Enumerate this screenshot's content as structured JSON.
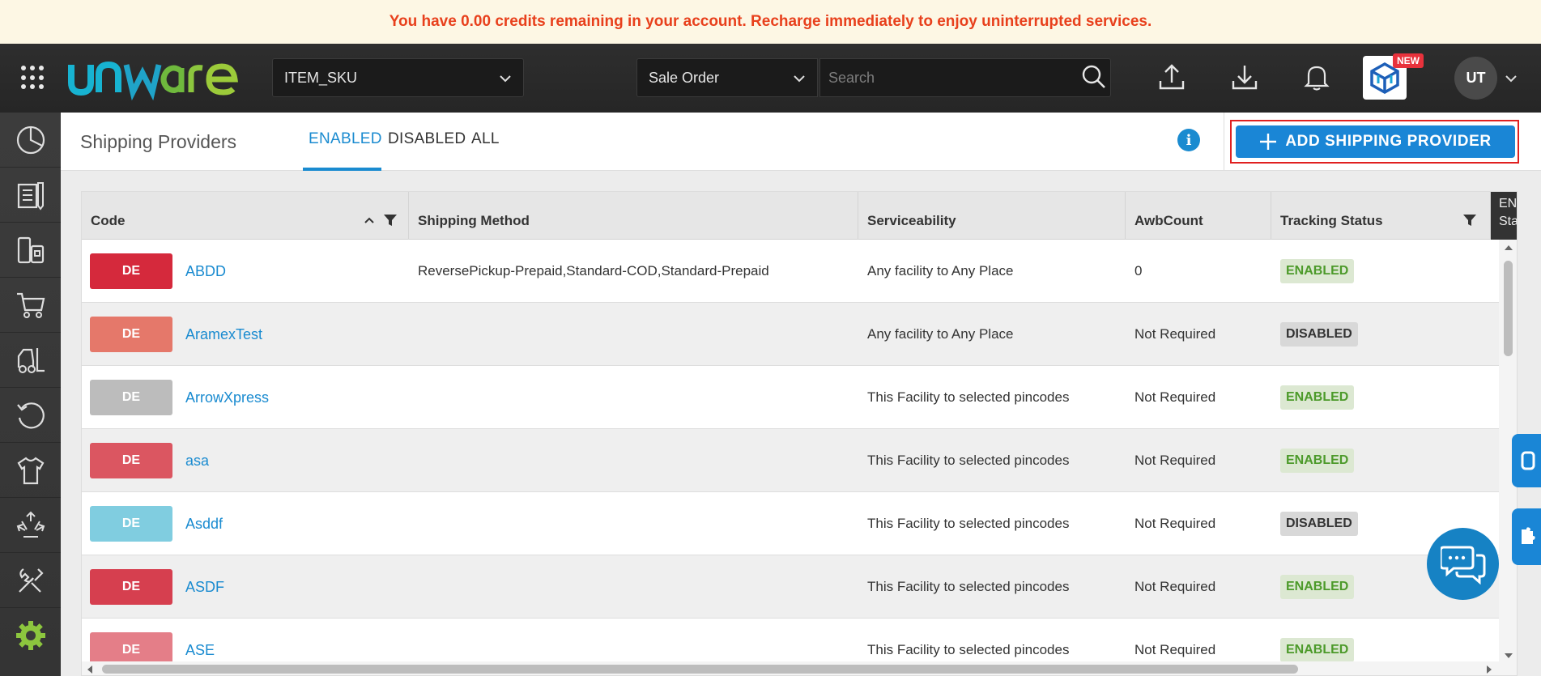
{
  "banner": {
    "text": "You have 0.00 credits remaining in your account. Recharge immediately to enjoy uninterrupted services."
  },
  "header": {
    "logo_text": "unware",
    "sku_select": "ITEM_SKU",
    "order_select": "Sale Order",
    "search_placeholder": "Search",
    "new_badge": "NEW",
    "avatar": "UT"
  },
  "sidebar": {
    "items": [
      "dashboard-icon",
      "orders-icon",
      "shipping-icon",
      "cart-icon",
      "forklift-icon",
      "returns-icon",
      "products-icon",
      "recycle-icon",
      "tools-icon",
      "settings-icon"
    ]
  },
  "page": {
    "title": "Shipping Providers",
    "tabs": [
      "ENABLED",
      "DISABLED",
      "ALL"
    ],
    "active_tab": "ENABLED",
    "add_button": "ADD SHIPPING PROVIDER"
  },
  "table": {
    "columns": [
      "Code",
      "Shipping Method",
      "Serviceability",
      "AwbCount",
      "Tracking Status"
    ],
    "extra_column": "EN\nSta",
    "rows": [
      {
        "badge": "DE",
        "badge_color": "#d5293c",
        "code": "ABDD",
        "method": "ReversePickup-Prepaid,Standard-COD,Standard-Prepaid",
        "serviceability": "Any facility to Any Place",
        "awb": "0",
        "status": "ENABLED"
      },
      {
        "badge": "DE",
        "badge_color": "#e5786a",
        "code": "AramexTest",
        "method": "",
        "serviceability": "Any facility to Any Place",
        "awb": "Not Required",
        "status": "DISABLED"
      },
      {
        "badge": "DE",
        "badge_color": "#bcbcbc",
        "code": "ArrowXpress",
        "method": "",
        "serviceability": "This Facility to selected pincodes",
        "awb": "Not Required",
        "status": "ENABLED"
      },
      {
        "badge": "DE",
        "badge_color": "#db5661",
        "code": "asa",
        "method": "",
        "serviceability": "This Facility to selected pincodes",
        "awb": "Not Required",
        "status": "ENABLED"
      },
      {
        "badge": "DE",
        "badge_color": "#80cde0",
        "code": "Asddf",
        "method": "",
        "serviceability": "This Facility to selected pincodes",
        "awb": "Not Required",
        "status": "DISABLED"
      },
      {
        "badge": "DE",
        "badge_color": "#d63f4f",
        "code": "ASDF",
        "method": "",
        "serviceability": "This Facility to selected pincodes",
        "awb": "Not Required",
        "status": "ENABLED"
      },
      {
        "badge": "DE",
        "badge_color": "#e47e88",
        "code": "ASE",
        "method": "",
        "serviceability": "This Facility to selected pincodes",
        "awb": "Not Required",
        "status": "ENABLED"
      }
    ]
  },
  "colors": {
    "accent": "#1a8bd0",
    "enabled": "#4c9a2a",
    "banner_text": "#e8401c"
  }
}
